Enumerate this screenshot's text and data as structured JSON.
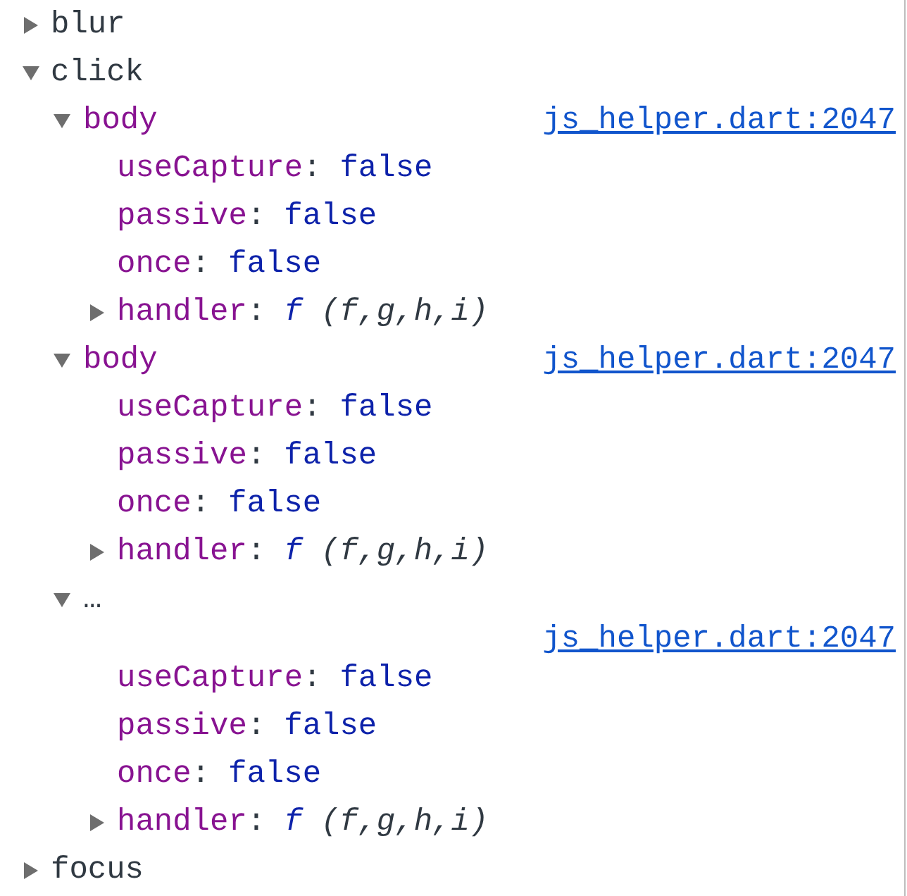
{
  "events": [
    {
      "name": "blur",
      "expanded": false
    },
    {
      "name": "click",
      "expanded": true,
      "listeners": [
        {
          "kind": "element",
          "name": "body",
          "expanded": true,
          "link": "js_helper.dart:2047",
          "properties": [
            {
              "kind": "boolean",
              "key": "useCapture",
              "separator": ":",
              "value": "false"
            },
            {
              "kind": "boolean",
              "key": "passive",
              "separator": ":",
              "value": "false"
            },
            {
              "kind": "boolean",
              "key": "once",
              "separator": ":",
              "value": "false"
            },
            {
              "kind": "function",
              "key": "handler",
              "separator": ":",
              "expanded": false,
              "keyword": "f",
              "value": "(f,g,h,i)"
            }
          ]
        },
        {
          "kind": "element",
          "name": "body",
          "expanded": true,
          "link": "js_helper.dart:2047",
          "properties": [
            {
              "kind": "boolean",
              "key": "useCapture",
              "separator": ":",
              "value": "false"
            },
            {
              "kind": "boolean",
              "key": "passive",
              "separator": ":",
              "value": "false"
            },
            {
              "kind": "boolean",
              "key": "once",
              "separator": ":",
              "value": "false"
            },
            {
              "kind": "function",
              "key": "handler",
              "separator": ":",
              "expanded": false,
              "keyword": "f",
              "value": "(f,g,h,i)"
            }
          ]
        },
        {
          "kind": "placeholder",
          "name": "…",
          "expanded": true,
          "link": "js_helper.dart:2047",
          "properties": [
            {
              "kind": "boolean",
              "key": "useCapture",
              "separator": ":",
              "value": "false"
            },
            {
              "kind": "boolean",
              "key": "passive",
              "separator": ":",
              "value": "false"
            },
            {
              "kind": "boolean",
              "key": "once",
              "separator": ":",
              "value": "false"
            },
            {
              "kind": "function",
              "key": "handler",
              "separator": ":",
              "expanded": false,
              "keyword": "f",
              "value": "(f,g,h,i)"
            }
          ]
        }
      ]
    },
    {
      "name": "focus",
      "expanded": false
    }
  ]
}
